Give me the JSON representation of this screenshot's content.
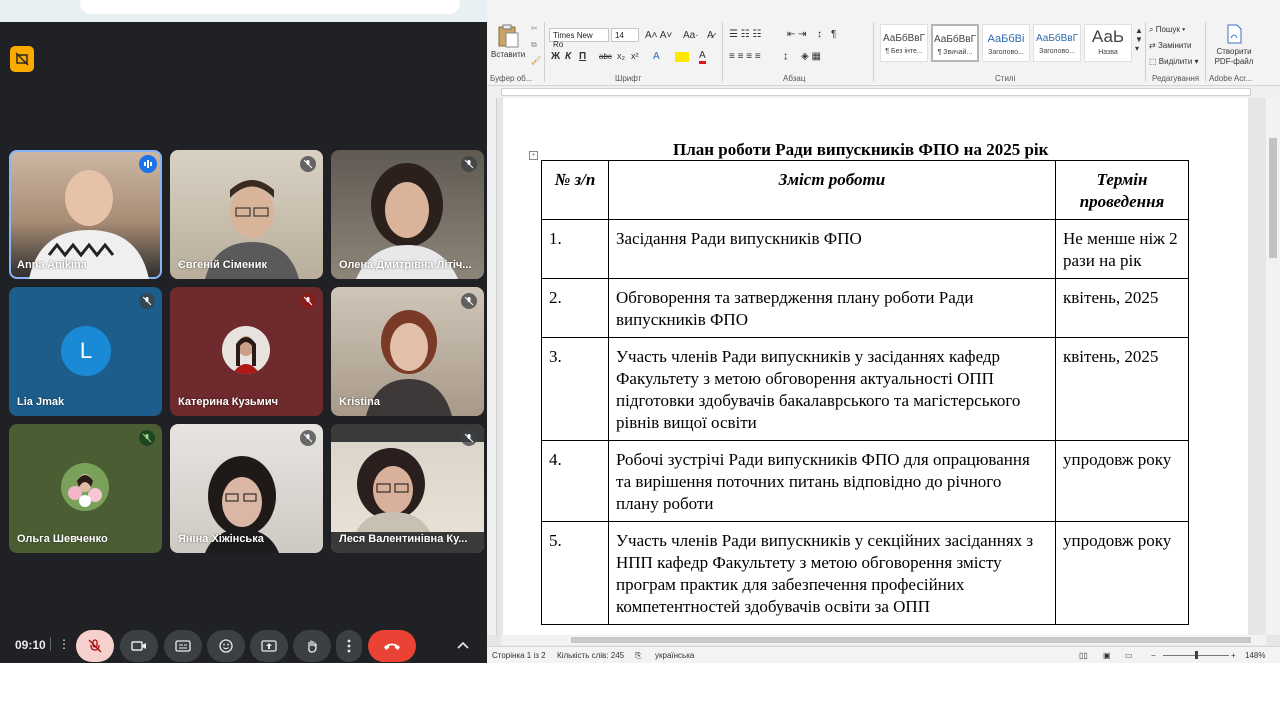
{
  "meet": {
    "clock": "09:10",
    "participants": [
      {
        "name": "Anna Anikina",
        "speaking": true
      },
      {
        "name": "Євгеній Сіменик",
        "muted": true
      },
      {
        "name": "Олена Дмитрівна Літіч...",
        "muted": true
      },
      {
        "name": "Lia Jmak",
        "initial": "L",
        "muted": true
      },
      {
        "name": "Катерина Кузьмич",
        "muted": true
      },
      {
        "name": "Kristina",
        "muted": true
      },
      {
        "name": "Ольга Шевченко",
        "muted": true
      },
      {
        "name": "Яніна Хіжінська",
        "muted": true
      },
      {
        "name": "Леся Валентинівна Ку...",
        "muted": true
      }
    ]
  },
  "word": {
    "ribbon": {
      "paste_label": "Вставити",
      "clipboard_label": "Буфер об...",
      "font_name": "Times New Ro",
      "font_size": "14",
      "font_group": "Шрифт",
      "paragraph_group": "Абзац",
      "styles_group": "Стилі",
      "editing_group": "Редагування",
      "adobe_group": "Adobe Acr...",
      "styles": [
        {
          "sample": "АаБбВвГ",
          "name": "¶ Без інте..."
        },
        {
          "sample": "АаБбВвГ",
          "name": "¶ Звичай..."
        },
        {
          "sample": "АаБбВі",
          "name": "Заголово..."
        },
        {
          "sample": "АаБбВвГ",
          "name": "Заголово..."
        },
        {
          "sample": "АаЬ",
          "name": "Назва"
        }
      ],
      "find": "Пошук",
      "replace": "Замінити",
      "select": "Виділити",
      "create_pdf": "Створити PDF-файл"
    },
    "document": {
      "title": "План роботи Ради випускників ФПО на 2025 рік",
      "headers": [
        "№ з/п",
        "Зміст роботи",
        "Термін проведення"
      ],
      "rows": [
        [
          "1.",
          "Засідання Ради випускників ФПО",
          "Не менше ніж 2 рази на рік"
        ],
        [
          "2.",
          "Обговорення та затвердження плану роботи Ради випускників ФПО",
          "квітень, 2025"
        ],
        [
          "3.",
          "Участь членів Ради випускників у засіданнях кафедр Факультету з метою обговорення актуальності ОПП підготовки здобувачів бакалаврського та магістерського рівнів вищої освіти",
          "квітень, 2025"
        ],
        [
          "4.",
          "Робочі зустрічі Ради випускників ФПО для опрацювання та вирішення поточних питань відповідно до річного плану роботи",
          "упродовж року"
        ],
        [
          "5.",
          "Участь членів Ради випускників у секційних засіданнях з НПП кафедр Факультету з метою обговорення змісту програм практик для забезпечення професійних компетентностей здобувачів освіти за ОПП",
          "упродовж року"
        ]
      ]
    },
    "status": {
      "page": "Сторінка 1 із 2",
      "words": "Кількість слів: 245",
      "language": "українська",
      "zoom": "148%"
    }
  }
}
